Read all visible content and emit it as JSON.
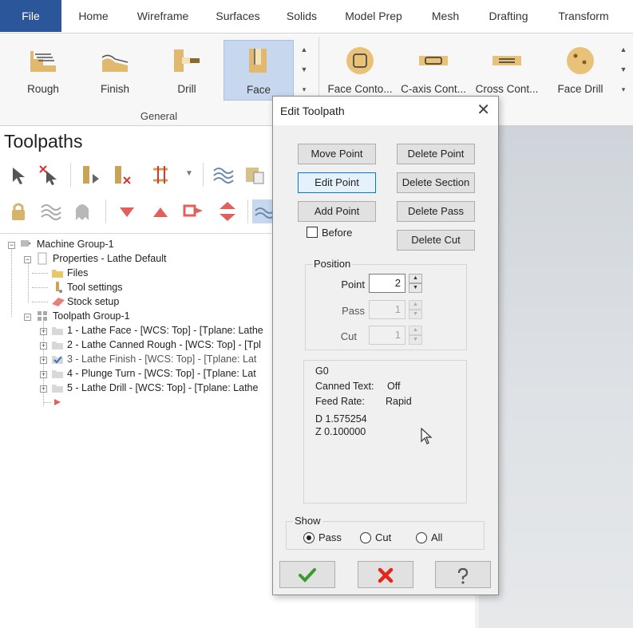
{
  "menu": [
    "File",
    "Home",
    "Wireframe",
    "Surfaces",
    "Solids",
    "Model Prep",
    "Mesh",
    "Drafting",
    "Transform"
  ],
  "ribbon": {
    "general_buttons": [
      "Rough",
      "Finish",
      "Drill",
      "Face"
    ],
    "selected": "Face",
    "general_label": "General",
    "second_buttons": [
      "Face Conto...",
      "C-axis Cont...",
      "Cross Cont...",
      "Face Drill"
    ]
  },
  "toolpaths": {
    "title": "Toolpaths",
    "tree": {
      "machine_group": "Machine Group-1",
      "properties": "Properties - Lathe Default",
      "files": "Files",
      "tool_settings": "Tool settings",
      "stock_setup": "Stock setup",
      "toolpath_group": "Toolpath Group-1",
      "ops": [
        "1 - Lathe Face - [WCS: Top] - [Tplane: Lathe",
        "2 - Lathe Canned Rough - [WCS: Top] - [Tpl",
        "3 - Lathe Finish - [WCS: Top] - [Tplane: Lat",
        "4 - Plunge Turn - [WCS: Top] - [Tplane: Lat",
        "5 - Lathe Drill - [WCS: Top] - [Tplane: Lathe"
      ]
    }
  },
  "dialog": {
    "title": "Edit Toolpath",
    "buttons": {
      "move_point": "Move Point",
      "delete_point": "Delete Point",
      "edit_point": "Edit Point",
      "delete_section": "Delete Section",
      "add_point": "Add Point",
      "delete_pass": "Delete Pass",
      "delete_cut": "Delete Cut"
    },
    "before_label": "Before",
    "position": {
      "title": "Position",
      "point_label": "Point",
      "point_value": "2",
      "pass_label": "Pass",
      "pass_value": "1",
      "cut_label": "Cut",
      "cut_value": "1"
    },
    "info": {
      "code": "G0",
      "canned_text_label": "Canned Text:",
      "canned_text_value": "Off",
      "feed_rate_label": "Feed Rate:",
      "feed_rate_value": "Rapid",
      "d_value": "D 1.575254",
      "z_value": "Z 0.100000"
    },
    "show": {
      "title": "Show",
      "options": [
        "Pass",
        "Cut",
        "All"
      ],
      "selected": "Pass"
    }
  },
  "colors": {
    "file_tab": "#2b579a",
    "ribbon_selected": "#c6d7ee",
    "ok_green": "#3a9a2e",
    "cancel_red": "#e0281e"
  }
}
